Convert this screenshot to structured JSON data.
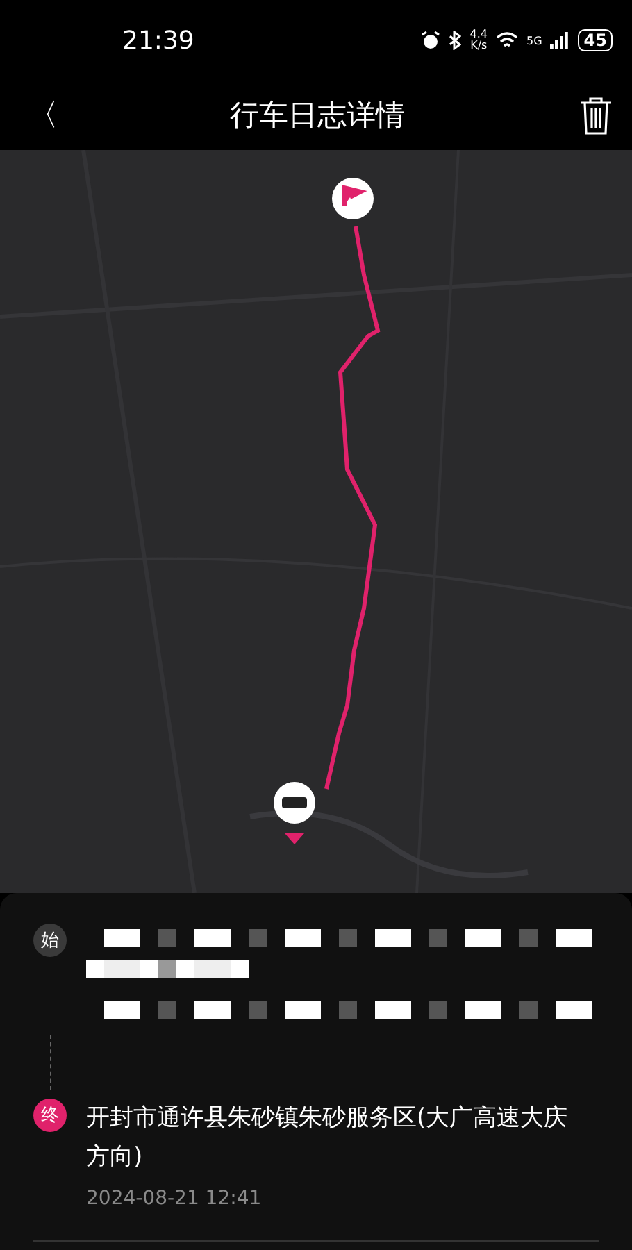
{
  "status_bar": {
    "time": "21:39",
    "speed_value": "4.4",
    "speed_unit": "K/s",
    "network": "5G",
    "battery": "45"
  },
  "header": {
    "back": "〈",
    "title": "行车日志详情"
  },
  "trip": {
    "points": [
      {
        "kind": "start",
        "badge": "始",
        "redacted": true
      },
      {
        "kind": "end",
        "badge": "终",
        "address": "开封市通许县朱砂镇朱砂服务区(大广高速大庆方向)",
        "time": "2024-08-21 12:41",
        "redacted": false
      }
    ]
  }
}
